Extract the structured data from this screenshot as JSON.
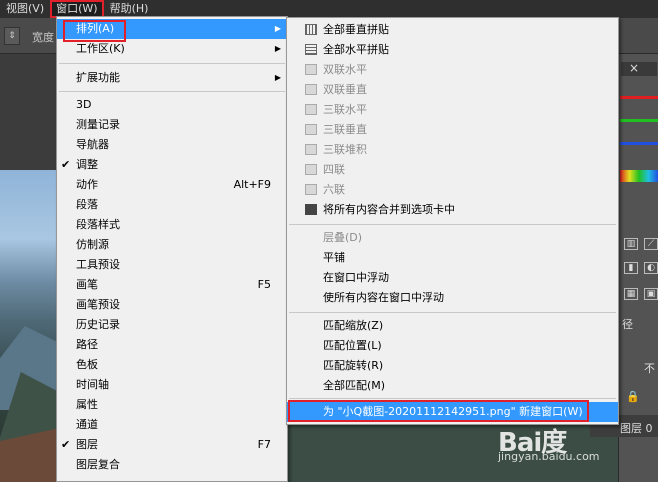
{
  "menubar": {
    "items": [
      {
        "label": "视图(V)"
      },
      {
        "label": "窗口(W)"
      },
      {
        "label": "帮助(H)"
      }
    ]
  },
  "optionsbar": {
    "stepper_icon": "up-down-arrows-icon",
    "width_label": "宽度"
  },
  "window_menu": {
    "items": [
      {
        "label": "排列(A)"
      },
      {
        "label": "工作区(K)"
      },
      {
        "label": "扩展功能"
      },
      {
        "label": "3D"
      },
      {
        "label": "测量记录"
      },
      {
        "label": "导航器"
      },
      {
        "label": "调整"
      },
      {
        "label": "动作",
        "shortcut": "Alt+F9"
      },
      {
        "label": "段落"
      },
      {
        "label": "段落样式"
      },
      {
        "label": "仿制源"
      },
      {
        "label": "工具预设"
      },
      {
        "label": "画笔",
        "shortcut": "F5"
      },
      {
        "label": "画笔预设"
      },
      {
        "label": "历史记录"
      },
      {
        "label": "路径"
      },
      {
        "label": "色板"
      },
      {
        "label": "时间轴"
      },
      {
        "label": "属性"
      },
      {
        "label": "通道"
      },
      {
        "label": "图层",
        "shortcut": "F7"
      },
      {
        "label": "图层复合"
      }
    ]
  },
  "arrange_menu": {
    "items": [
      {
        "label": "全部垂直拼贴"
      },
      {
        "label": "全部水平拼贴"
      },
      {
        "label": "双联水平"
      },
      {
        "label": "双联垂直"
      },
      {
        "label": "三联水平"
      },
      {
        "label": "三联垂直"
      },
      {
        "label": "三联堆积"
      },
      {
        "label": "四联"
      },
      {
        "label": "六联"
      },
      {
        "label": "将所有内容合并到选项卡中"
      },
      {
        "label": "层叠(D)"
      },
      {
        "label": "平铺"
      },
      {
        "label": "在窗口中浮动"
      },
      {
        "label": "使所有内容在窗口中浮动"
      },
      {
        "label": "匹配缩放(Z)"
      },
      {
        "label": "匹配位置(L)"
      },
      {
        "label": "匹配旋转(R)"
      },
      {
        "label": "全部匹配(M)"
      },
      {
        "label": "为 \"小Q截图-20201112142951.png\" 新建窗口(W)"
      }
    ]
  },
  "right_panel": {
    "tab_label": "径",
    "blend_label": "不",
    "layer_label": "图层 0",
    "colors": {
      "red": "#e02020",
      "green": "#20c020",
      "blue": "#2050e0",
      "accent": "#3399ff"
    }
  },
  "watermark": {
    "logo": "Bai度",
    "url": "jingyan.baidu.com"
  }
}
